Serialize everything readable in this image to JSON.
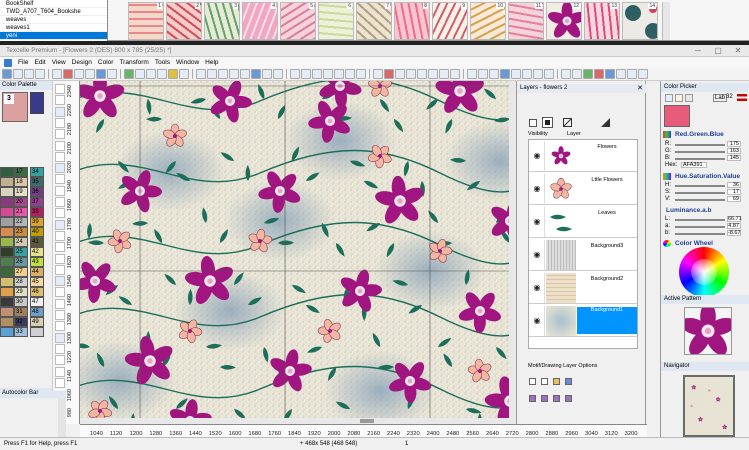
{
  "recent_files": [
    "BookShelf",
    "TWD_A707_T604_Bookshe",
    "weaves",
    "weaves1",
    "yeni"
  ],
  "selected_recent": 4,
  "thumbnails": [
    {
      "num": "1",
      "bg": "#f6d6c6",
      "fg": "#e58a8a"
    },
    {
      "num": "2",
      "bg": "#f5cdc6",
      "fg": "#d44a5a"
    },
    {
      "num": "3",
      "bg": "#e4ecd6",
      "fg": "#6aa06a"
    },
    {
      "num": "4",
      "bg": "#f2a6c2",
      "fg": "#f8e0ea"
    },
    {
      "num": "5",
      "bg": "#f7d2d8",
      "fg": "#d77ea0"
    },
    {
      "num": "6",
      "bg": "#ecf2d9",
      "fg": "#c9da9a"
    },
    {
      "num": "7",
      "bg": "#e9e4d3",
      "fg": "#b79c74"
    },
    {
      "num": "8",
      "bg": "#f9c4cf",
      "fg": "#ee6e86"
    },
    {
      "num": "9",
      "bg": "#f7f1e1",
      "fg": "#d35b7a"
    },
    {
      "num": "10",
      "bg": "#f8ead6",
      "fg": "#d7a04a"
    },
    {
      "num": "11",
      "bg": "#f3d4db",
      "fg": "#e87e9a"
    },
    {
      "num": "12",
      "bg": "#f1ede4",
      "fg": "#9a1f8a"
    },
    {
      "num": "13",
      "bg": "#f8d7e0",
      "fg": "#e24c78"
    },
    {
      "num": "14",
      "bg": "#ede9e5",
      "fg": "#2e5f62"
    }
  ],
  "window": {
    "title": "Texcelle Premium - [Flowers 2 (DES) 800 x 785 (25/25) *]",
    "minimize": "─",
    "maximize": "▢",
    "close": "✕"
  },
  "menu": [
    "File",
    "Edit",
    "View",
    "Design",
    "Color",
    "Transform",
    "Tools",
    "Window",
    "Help"
  ],
  "palette": {
    "title": "Color Palette",
    "close": "✕",
    "big_index": "3",
    "rows": [
      {
        "left": "",
        "lc": "#2f5f3e",
        "right": "17",
        "rc": "#3b6b45",
        "right2": "34",
        "rc2": "#37a0a0"
      },
      {
        "left": "",
        "lc": "#c0b090",
        "right": "18",
        "rc": "#d8c9a8",
        "right2": "35",
        "rc2": "#3d6b6b"
      },
      {
        "left": "",
        "lc": "#dad3bd",
        "right": "19",
        "rc": "#e6dfc9",
        "right2": "36",
        "rc2": "#704080"
      },
      {
        "left": "",
        "lc": "#8a3a7a",
        "right": "20",
        "rc": "#a14a8a",
        "right2": "37",
        "rc2": "#904090"
      },
      {
        "left": "",
        "lc": "#d64b98",
        "right": "21",
        "rc": "#e25aa8",
        "right2": "38",
        "rc2": "#b22060"
      },
      {
        "left": "",
        "lc": "#a0a0a0",
        "right": "22",
        "rc": "#b6b6b6",
        "right2": "39",
        "rc2": "#e0a030"
      },
      {
        "left": "",
        "lc": "#d68c4c",
        "right": "23",
        "rc": "#c88e3e",
        "right2": "40",
        "rc2": "#c0a000"
      },
      {
        "left": "",
        "lc": "#9ab84a",
        "right": "24",
        "rc": "#d0c8b0",
        "right2": "41",
        "rc2": "#5a5a3a"
      },
      {
        "left": "",
        "lc": "#2f3f2a",
        "right": "25",
        "rc": "#3aa0a0",
        "right2": "42",
        "rc2": "#e8e090"
      },
      {
        "left": "",
        "lc": "#4e7e4e",
        "right": "26",
        "rc": "#6a9aa0",
        "right2": "43",
        "rc2": "#c0e040"
      },
      {
        "left": "",
        "lc": "#3a6a3a",
        "right": "27",
        "rc": "#f0d090",
        "right2": "44",
        "rc2": "#d8b06a"
      },
      {
        "left": "",
        "lc": "#d0c070",
        "right": "28",
        "rc": "#d0d0d0",
        "right2": "45",
        "rc2": "#f4d8a0"
      },
      {
        "left": "",
        "lc": "#e0a04a",
        "right": "29",
        "rc": "#e0e0c0",
        "right2": "46",
        "rc2": "#e0c070"
      },
      {
        "left": "",
        "lc": "#3a3a3a",
        "right": "30",
        "rc": "#c8c8c8",
        "right2": "47",
        "rc2": "#f0f0f0"
      },
      {
        "left": "",
        "lc": "#c09070",
        "right": "31",
        "rc": "#a08060",
        "right2": "48",
        "rc2": "#70a0c8"
      },
      {
        "left": "",
        "lc": "#b09060",
        "right": "32",
        "rc": "#3a3a5a",
        "right2": "49",
        "rc2": "#d8d0b0"
      },
      {
        "left": "",
        "lc": "#5aa0d0",
        "right": "33",
        "rc": "#a0c0d8",
        "right2": "",
        "rc2": "#d0d0d0"
      }
    ],
    "autocolor": "Autocolor Bar"
  },
  "vruler_labels": [
    "2340",
    "2260",
    "2180",
    "2100",
    "2020",
    "1940",
    "1860",
    "1780",
    "1700",
    "1620",
    "1540",
    "1460",
    "1380",
    "1300",
    "1220",
    "1140",
    "1060",
    "980"
  ],
  "hruler_labels": [
    "1040",
    "1120",
    "1200",
    "1280",
    "1360",
    "1440",
    "1520",
    "1600",
    "1680",
    "1760",
    "1840",
    "1920",
    "2000",
    "2080",
    "2160",
    "2240",
    "2320",
    "2400",
    "2480",
    "2560",
    "2640",
    "2720",
    "2800",
    "2880",
    "2960",
    "3040",
    "3120",
    "3200"
  ],
  "layers": {
    "title": "Layers - flowers 2",
    "close": "✕",
    "col_visibility": "Visibility",
    "col_layer": "Layer",
    "items": [
      {
        "name": "Flowers",
        "thumb": "flowers"
      },
      {
        "name": "Lttle Flowers",
        "thumb": "little"
      },
      {
        "name": "Leaves",
        "thumb": "leaves"
      },
      {
        "name": "Background3",
        "thumb": "bg3"
      },
      {
        "name": "Background2",
        "thumb": "bg2"
      },
      {
        "name": "Background1",
        "thumb": "bg1"
      }
    ],
    "selected": 5,
    "options_label": "Motif/Drawing Layer Options"
  },
  "color_picker": {
    "title": "Color Picker",
    "current_color": "#e85b7b",
    "rgb_title": "Red.Green.Blue",
    "r_label": "R:",
    "r_val": "175",
    "g_label": "G:",
    "g_val": "163",
    "b_label": "B:",
    "b_val": "145",
    "hex_label": "Hex:",
    "hex_val": "AFA391",
    "hsv_title": "Hue.Saturation.Value",
    "h_label": "H:",
    "h_val": "36",
    "s_label": "S:",
    "s_val": "17",
    "v_label": "V:",
    "v_val": "69",
    "lab_title": "Luminance.a.b",
    "l_label": "L:",
    "l_val": "66.71",
    "a_label": "a:",
    "a_val": "4.87",
    "bb_label": "b:",
    "bb_val": "-8.67",
    "wheel_title": "Color Wheel",
    "active_pattern_title": "Active Pattern",
    "navigator_title": "Navigator",
    "mode_lab": "Lab",
    "mode_num": "32"
  },
  "status": {
    "help": "Press F1 for Help, press F1",
    "coords": "+ 468x 548 (468 548)",
    "zoom": "1"
  },
  "colors": {
    "magenta": "#a0157f",
    "teal": "#1c6e5a",
    "peach": "#f2b7a2",
    "blue_gray": "#98aebe",
    "accent": "#0094ff"
  }
}
